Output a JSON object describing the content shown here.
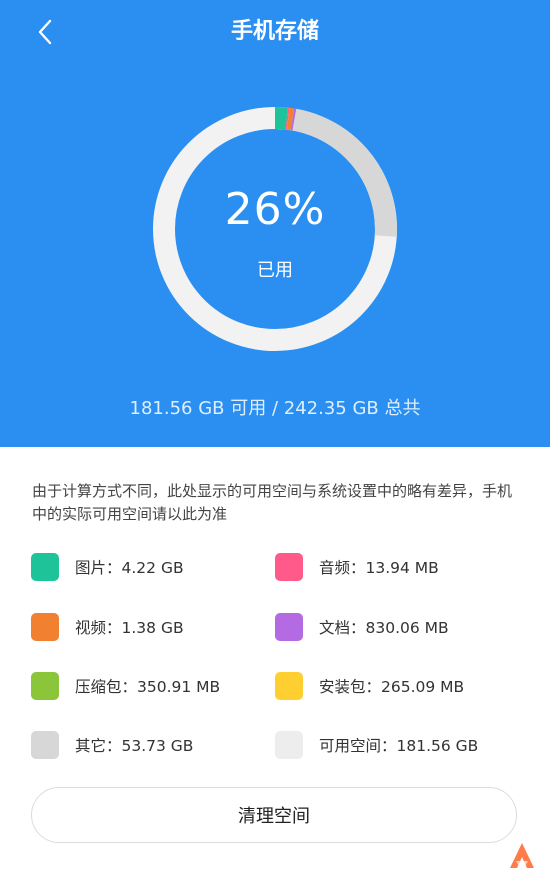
{
  "header": {
    "title": "手机存储",
    "back_icon": "chevron-left-icon"
  },
  "storage": {
    "used_percent_text": "26%",
    "used_label": "已用",
    "summary": "181.56 GB 可用 / 242.35 GB 总共",
    "ring_fill_fraction": 0.26,
    "ring_segments": [
      {
        "name": "图片",
        "color": "#1fc39a",
        "fraction": 0.017
      },
      {
        "name": "音频",
        "color": "#ff5a8a",
        "fraction": 0.002
      },
      {
        "name": "视频",
        "color": "#f28031",
        "fraction": 0.006
      },
      {
        "name": "文档",
        "color": "#b36ae2",
        "fraction": 0.003
      },
      {
        "name": "其它",
        "color": "#d7d7d7",
        "fraction": 0.232
      }
    ],
    "ring_free_color": "#f2f2f2"
  },
  "note": "由于计算方式不同，此处显示的可用空间与系统设置中的略有差异，手机中的实际可用空间请以此为准",
  "legend": [
    {
      "label": "图片：4.22 GB",
      "color": "#1fc39a"
    },
    {
      "label": "音频：13.94 MB",
      "color": "#ff5a8a"
    },
    {
      "label": "视频：1.38 GB",
      "color": "#f28031"
    },
    {
      "label": "文档：830.06 MB",
      "color": "#b36ae2"
    },
    {
      "label": "压缩包：350.91 MB",
      "color": "#8ac53a"
    },
    {
      "label": "安装包：265.09 MB",
      "color": "#ffcf31"
    },
    {
      "label": "其它：53.73 GB",
      "color": "#d7d7d7"
    },
    {
      "label": "可用空间：181.56 GB",
      "color": "#ededed"
    }
  ],
  "actions": {
    "clean_label": "清理空间"
  },
  "brand": {
    "logo_icon": "app-logo-icon",
    "logo_color": "#ff7b4a"
  }
}
